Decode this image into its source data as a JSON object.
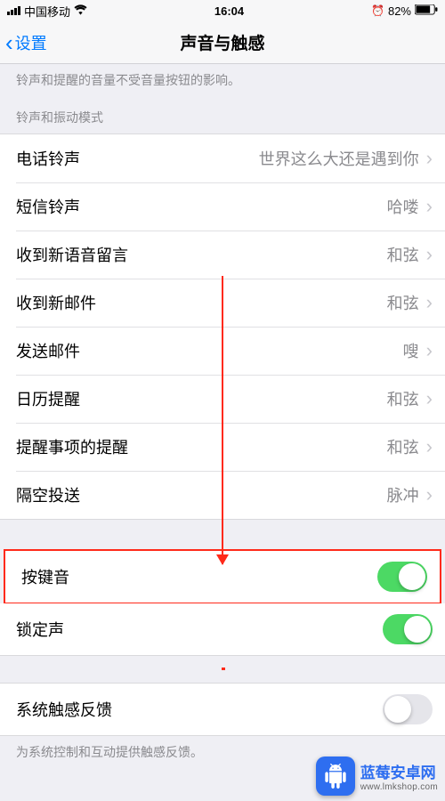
{
  "status": {
    "carrier": "中国移动",
    "time": "16:04",
    "battery_pct": "82%"
  },
  "nav": {
    "back_label": "设置",
    "title": "声音与触感"
  },
  "note_top": "铃声和提醒的音量不受音量按钮的影响。",
  "section_ringtone_header": "铃声和振动模式",
  "rows": {
    "phone_ringtone": {
      "label": "电话铃声",
      "value": "世界这么大还是遇到你"
    },
    "sms_ringtone": {
      "label": "短信铃声",
      "value": "哈喽"
    },
    "new_voicemail": {
      "label": "收到新语音留言",
      "value": "和弦"
    },
    "new_mail": {
      "label": "收到新邮件",
      "value": "和弦"
    },
    "send_mail": {
      "label": "发送邮件",
      "value": "嗖"
    },
    "calendar_alert": {
      "label": "日历提醒",
      "value": "和弦"
    },
    "reminder_alert": {
      "label": "提醒事项的提醒",
      "value": "和弦"
    },
    "airdrop": {
      "label": "隔空投送",
      "value": "脉冲"
    }
  },
  "toggles": {
    "key_click": {
      "label": "按键音",
      "on": true
    },
    "lock_sound": {
      "label": "锁定声",
      "on": true
    },
    "haptic": {
      "label": "系统触感反馈",
      "on": false
    }
  },
  "footer_note": "为系统控制和互动提供触感反馈。",
  "watermark": {
    "title": "蓝莓安卓网",
    "url": "www.lmkshop.com"
  }
}
